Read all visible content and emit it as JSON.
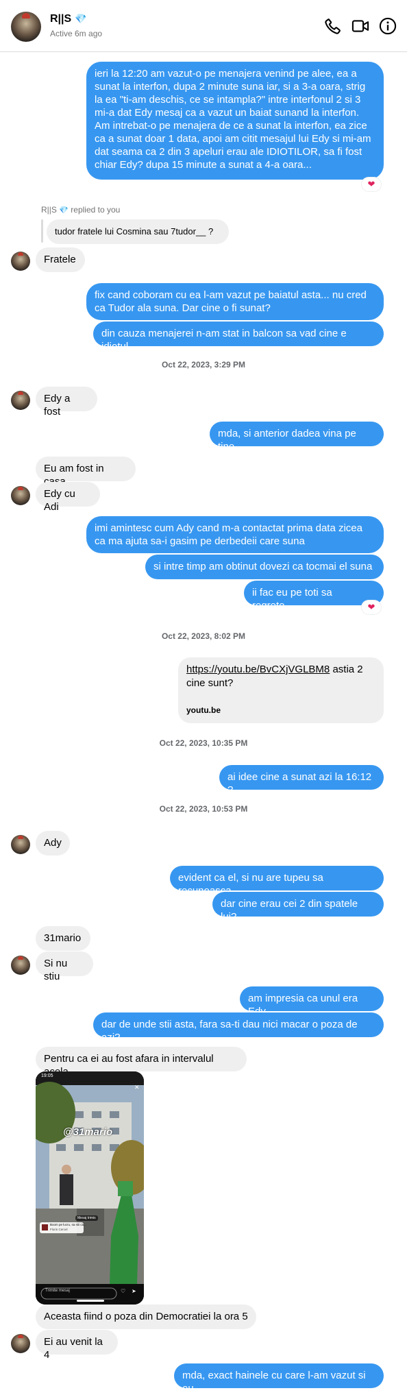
{
  "header": {
    "name": "R||S",
    "status": "Active 6m ago",
    "icons": [
      "phone-icon",
      "video-icon",
      "info-icon"
    ]
  },
  "colors": {
    "outgoing": "#3797f0",
    "incoming": "#efefef",
    "heart": "#e0245e"
  },
  "messages": {
    "m1": "ieri la 12:20 am vazut-o pe menajera venind pe alee, ea a sunat la interfon, dupa 2 minute suna iar, si a 3-a oara, strig la ea \"ti-am deschis, ce se intampla?\" intre interfonul 2 si 3 mi-a dat Edy mesaj ca a vazut un baiat sunand la interfon. Am intrebat-o pe menajera de ce a sunat la interfon, ea zice ca a sunat doar 1 data, apoi am citit mesajul lui Edy si mi-am dat seama ca 2 din 3 apeluri erau ale IDIOTILOR, sa fi fost chiar Edy? dupa 15 minute a sunat a 4-a oara...",
    "reply_label": "replied to you",
    "reply_quote": "tudor fratele lui Cosmina sau 7tudor__ ?",
    "m2": "Fratele",
    "m3": "fix cand coboram cu ea l-am vazut pe baiatul asta... nu cred ca Tudor ala suna. Dar cine o fi sunat?",
    "m4": "din cauza menajerei n-am stat in balcon sa vad cine e idiotul",
    "ts1": "Oct 22, 2023, 3:29 PM",
    "m5": "Edy a fost",
    "m6": "mda, si anterior dadea vina pe tine",
    "m7": "Eu am fost in casa",
    "m8": "Edy cu Adi",
    "m9": "imi amintesc cum Ady cand m-a contactat prima data zicea ca ma ajuta sa-i gasim pe derbedeii care suna",
    "m10": "si intre timp am obtinut dovezi ca tocmai el suna",
    "m11": "ii fac eu pe toti sa regrete...",
    "ts2": "Oct 22, 2023, 8:02 PM",
    "link_url": "https://youtu.be/BvCXjVGLBM8",
    "link_rest": " astia 2 cine sunt?",
    "link_domain": "youtu.be",
    "ts3": "Oct 22, 2023, 10:35 PM",
    "m12": "ai idee cine a sunat azi la 16:12 ?",
    "ts4": "Oct 22, 2023, 10:53 PM",
    "m13": "Ady",
    "m14": "evident ca el, si nu are tupeu sa recunoasca",
    "m15": "dar cine erau cei 2 din spatele lui?",
    "m16": "31mario",
    "m17": "Si nu stiu",
    "m18": "am impresia ca unul era Edy",
    "m19": "dar de unde stii asta, fara sa-ti dau nici macar o poza de azi?",
    "m20": "Pentru ca ei au fost afara in intervalul acela",
    "m21": "Aceasta fiind o poza din Democratiei la ora 5",
    "m22": "Ei au venit la 4",
    "m23": "mda, exact hainele cu care l-am vazut si eu"
  },
  "story": {
    "time": "19:05",
    "overlay": "@31mario",
    "music_label": "Boom pe lucru, sa stii ca...",
    "music_artist": "Florin Cercel",
    "sticker": "Mesaj trimis",
    "reply_placeholder": "Trimite mesaj"
  }
}
